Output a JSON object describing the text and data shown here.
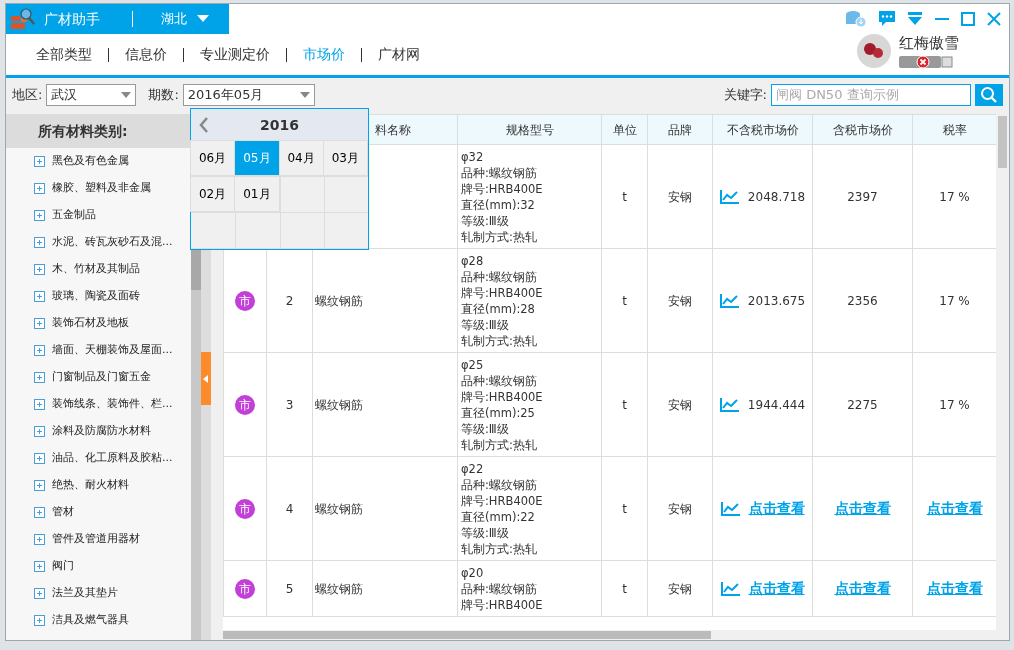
{
  "app": {
    "title": "广材助手",
    "region": "湖北"
  },
  "tabs": [
    {
      "label": "全部类型",
      "selected": false
    },
    {
      "label": "信息价",
      "selected": false
    },
    {
      "label": "专业测定价",
      "selected": false
    },
    {
      "label": "市场价",
      "selected": true
    },
    {
      "label": "广材网",
      "selected": false
    }
  ],
  "user": {
    "name": "红梅傲雪",
    "online": false
  },
  "filters": {
    "area_label": "地区:",
    "area": "武汉",
    "period_label": "期数:",
    "period": "2016年05月",
    "keyword_label": "关键字:",
    "keyword_placeholder": "闸阀 DN50 查询示例"
  },
  "period_picker": {
    "year": "2016",
    "months": [
      {
        "label": "06月",
        "selected": false
      },
      {
        "label": "05月",
        "selected": true
      },
      {
        "label": "04月",
        "selected": false
      },
      {
        "label": "03月",
        "selected": false
      },
      {
        "label": "02月",
        "selected": false
      },
      {
        "label": "01月",
        "selected": false
      }
    ]
  },
  "sidebar": {
    "header": "所有材料类别:",
    "items": [
      {
        "label": "黑色及有色金属"
      },
      {
        "label": "橡胶、塑料及非金属"
      },
      {
        "label": "五金制品"
      },
      {
        "label": "水泥、砖瓦灰砂石及混..."
      },
      {
        "label": "木、竹材及其制品"
      },
      {
        "label": "玻璃、陶瓷及面砖"
      },
      {
        "label": "装饰石材及地板"
      },
      {
        "label": "墙面、天棚装饰及屋面..."
      },
      {
        "label": "门窗制品及门窗五金"
      },
      {
        "label": "装饰线条、装饰件、栏..."
      },
      {
        "label": "涂料及防腐防水材料"
      },
      {
        "label": "油品、化工原料及胶粘..."
      },
      {
        "label": "绝热、耐火材料"
      },
      {
        "label": "管材"
      },
      {
        "label": "管件及管道用器材"
      },
      {
        "label": "阀门"
      },
      {
        "label": "法兰及其垫片"
      },
      {
        "label": "洁具及燃气器具"
      }
    ]
  },
  "table": {
    "columns": [
      "料名称",
      "规格型号",
      "单位",
      "品牌",
      "不含税市场价",
      "含税市场价",
      "税率"
    ],
    "rows": [
      {
        "kind": "value",
        "spec": [
          "φ32",
          "品种:螺纹钢筋",
          "牌号:HRB400E",
          "直径(mm):32",
          "等级:Ⅲ级",
          "轧制方式:热轧"
        ],
        "unit": "t",
        "brand": "安钢",
        "price_ex": "2048.718",
        "price_in": "2397",
        "tax": "17 %"
      },
      {
        "kind": "value",
        "badge": "市",
        "index": "2",
        "name": "螺纹钢筋",
        "spec": [
          "φ28",
          "品种:螺纹钢筋",
          "牌号:HRB400E",
          "直径(mm):28",
          "等级:Ⅲ级",
          "轧制方式:热轧"
        ],
        "unit": "t",
        "brand": "安钢",
        "price_ex": "2013.675",
        "price_in": "2356",
        "tax": "17 %"
      },
      {
        "kind": "value",
        "badge": "市",
        "index": "3",
        "name": "螺纹钢筋",
        "spec": [
          "φ25",
          "品种:螺纹钢筋",
          "牌号:HRB400E",
          "直径(mm):25",
          "等级:Ⅲ级",
          "轧制方式:热轧"
        ],
        "unit": "t",
        "brand": "安钢",
        "price_ex": "1944.444",
        "price_in": "2275",
        "tax": "17 %"
      },
      {
        "kind": "link",
        "badge": "市",
        "index": "4",
        "name": "螺纹钢筋",
        "spec": [
          "φ22",
          "品种:螺纹钢筋",
          "牌号:HRB400E",
          "直径(mm):22",
          "等级:Ⅲ级",
          "轧制方式:热轧"
        ],
        "unit": "t",
        "brand": "安钢",
        "price_ex": "点击查看",
        "price_in": "点击查看",
        "tax": "点击查看"
      },
      {
        "kind": "link",
        "badge": "市",
        "index": "5",
        "name": "螺纹钢筋",
        "spec": [
          "φ20",
          "品种:螺纹钢筋",
          "牌号:HRB400E"
        ],
        "unit": "t",
        "brand": "安钢",
        "price_ex": "点击查看",
        "price_in": "点击查看",
        "tax": "点击查看"
      }
    ]
  }
}
